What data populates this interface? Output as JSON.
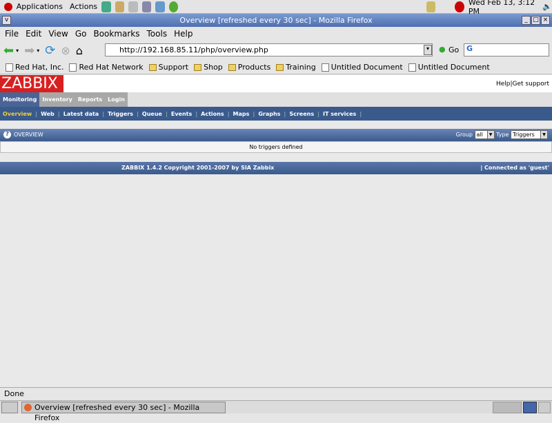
{
  "panel": {
    "applications": "Applications",
    "actions": "Actions",
    "clock": "Wed Feb 13,  3:12 PM"
  },
  "window": {
    "title": "Overview [refreshed every 30 sec] - Mozilla Firefox"
  },
  "menu": [
    "File",
    "Edit",
    "View",
    "Go",
    "Bookmarks",
    "Tools",
    "Help"
  ],
  "nav": {
    "url": "http://192.168.85.11/php/overview.php",
    "go": "Go"
  },
  "bookmarks": [
    "Red Hat, Inc.",
    "Red Hat Network",
    "Support",
    "Shop",
    "Products",
    "Training",
    "Untitled Document",
    "Untitled Document"
  ],
  "zabbix": {
    "logo": "ZABBIX",
    "help": "Help|Get support",
    "tabs": [
      "Monitoring",
      "Inventory",
      "Reports",
      "Login"
    ],
    "subnav": [
      "Overview",
      "Web",
      "Latest data",
      "Triggers",
      "Queue",
      "Events",
      "Actions",
      "Maps",
      "Graphs",
      "Screens",
      "IT services"
    ],
    "overview": {
      "title": "OVERVIEW",
      "group_label": "Group",
      "group_value": "all",
      "type_label": "Type",
      "type_value": "Triggers",
      "empty": "No triggers defined"
    },
    "footer": {
      "copyright": "ZABBIX 1.4.2 Copyright 2001-2007 by  SIA Zabbix",
      "connected": "Connected as 'guest'"
    }
  },
  "status": "Done",
  "taskbar": {
    "task": "Overview [refreshed every 30 sec] - Mozilla Firefox"
  }
}
